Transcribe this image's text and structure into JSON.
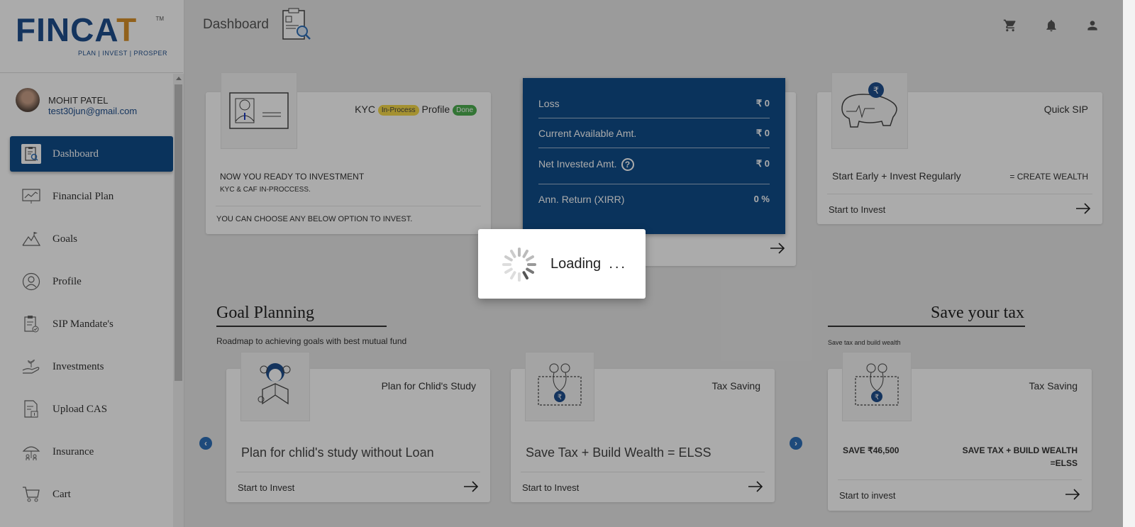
{
  "brand": {
    "name_left": "FINCA",
    "name_right": "T",
    "tm": "TM",
    "tagline": "PLAN | INVEST | PROSPER"
  },
  "user": {
    "name": "MOHIT PATEL",
    "email": "test30jun@gmail.com"
  },
  "nav": [
    {
      "label": "Dashboard",
      "icon": "dashboard-icon"
    },
    {
      "label": "Financial Plan",
      "icon": "chart-icon"
    },
    {
      "label": "Goals",
      "icon": "goals-icon"
    },
    {
      "label": "Profile",
      "icon": "profile-icon"
    },
    {
      "label": "SIP Mandate's",
      "icon": "clipboard-icon"
    },
    {
      "label": "Investments",
      "icon": "invest-icon"
    },
    {
      "label": "Upload CAS",
      "icon": "upload-icon"
    },
    {
      "label": "Insurance",
      "icon": "umbrella-icon"
    },
    {
      "label": "Cart",
      "icon": "cart-icon"
    }
  ],
  "topbar": {
    "title": "Dashboard"
  },
  "kyc_card": {
    "kyc_label": "KYC",
    "kyc_status": "In-Process",
    "profile_label": "Profile",
    "profile_status": "Done",
    "line1": "NOW YOU READY TO INVESTMENT",
    "line2": "KYC & CAF IN-PROCCESS.",
    "footer": "YOU CAN CHOOSE ANY BELOW OPTION TO INVEST."
  },
  "stats": [
    {
      "label": "Loss",
      "value": "₹ 0"
    },
    {
      "label": "Current Available Amt.",
      "value": "₹ 0"
    },
    {
      "label": "Net Invested Amt.",
      "value": "₹ 0",
      "help": "?"
    },
    {
      "label": "Ann. Return (XIRR)",
      "value": "0 %"
    }
  ],
  "quick_sip": {
    "title": "Quick SIP",
    "slogan_left": "Start Early + Invest Regularly",
    "slogan_right": "= CREATE WEALTH",
    "cta": "Start to Invest"
  },
  "goal_planning": {
    "title": "Goal Planning",
    "subtitle": "Roadmap to achieving goals with best mutual fund",
    "cards": [
      {
        "title": "Plan for Chlid's Study",
        "body": "Plan for chlid's study without Loan",
        "cta": "Start to Invest"
      },
      {
        "title": "Tax Saving",
        "body": "Save Tax + Build Wealth = ELSS",
        "cta": "Start to Invest"
      }
    ]
  },
  "save_tax": {
    "title": "Save your tax",
    "subtitle": "Save tax and build wealth",
    "card_title": "Tax Saving",
    "left": "SAVE ₹46,500",
    "right1": "SAVE TAX + BUILD WEALTH",
    "right2": "=ELSS",
    "cta": "Start to invest"
  },
  "loading": {
    "text": "Loading",
    "dots": "..."
  },
  "colors": {
    "primary": "#0f4c8a",
    "brand_orange": "#d8912a",
    "badge_yellow": "#f5d94a",
    "badge_green": "#4caf50"
  }
}
